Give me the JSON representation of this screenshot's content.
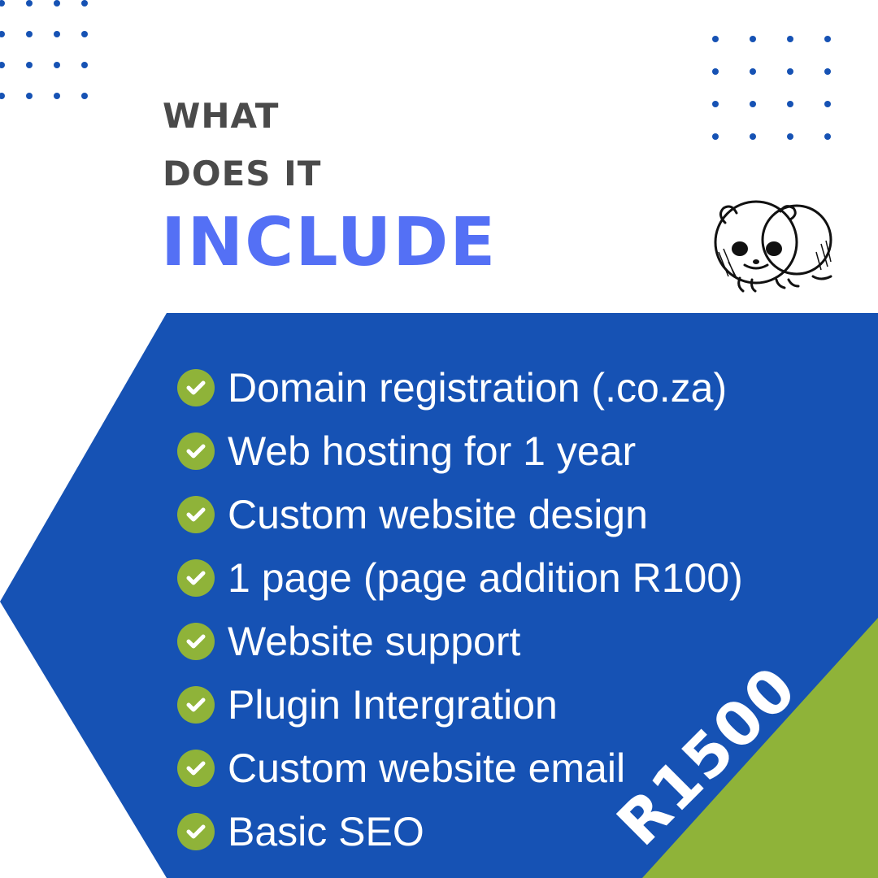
{
  "heading": {
    "line1": "WHAT",
    "line2": "DOES IT",
    "line3": "INCLUDE"
  },
  "features": [
    {
      "label": "Domain registration (.co.za)"
    },
    {
      "label": "Web hosting for 1 year"
    },
    {
      "label": "Custom website design"
    },
    {
      "label": "1 page (page addition R100)"
    },
    {
      "label": "Website support"
    },
    {
      "label": "Plugin Intergration"
    },
    {
      "label": "Custom website email"
    },
    {
      "label": "Basic SEO"
    }
  ],
  "price": "R1500",
  "icons": {
    "check": "check-circle-icon",
    "mascot": "panda-icon"
  },
  "colors": {
    "heading_gray": "#4a4a4a",
    "heading_accent": "#5470f5",
    "panel_blue": "#1652b4",
    "accent_green": "#8fb339",
    "dots": "#1652b4"
  }
}
